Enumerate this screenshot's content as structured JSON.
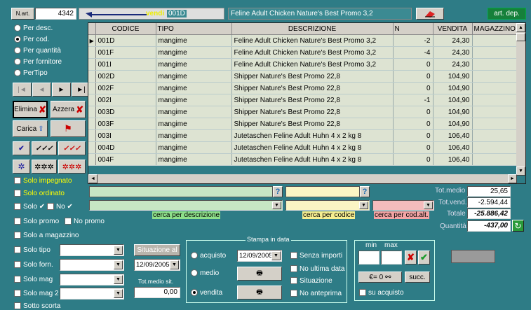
{
  "top": {
    "nart_label": "N.art.",
    "nart_value": "4342",
    "mode_label": "vendi",
    "code_value": "001D",
    "description_value": "Feline Adult Chicken Nature's Best Promo 3,2",
    "art_dep_label": "art. dep."
  },
  "sort": {
    "options": [
      "Per desc.",
      "Per cod.",
      "Per quantità",
      "Per fornitore",
      "PerTipo"
    ]
  },
  "buttons": {
    "elimina": "Elimina",
    "azzera": "Azzera",
    "carica": "Carica"
  },
  "grid": {
    "columns": [
      "CODICE",
      "TIPO",
      "DESCRIZIONE",
      "N",
      "VENDITA",
      "MAGAZZINO"
    ],
    "rows": [
      [
        "001D",
        "mangime",
        "Feline Adult Chicken Nature's Best Promo 3,2",
        "-2",
        "24,30",
        ""
      ],
      [
        "001F",
        "mangime",
        "Feline Adult Chicken Nature's Best Promo 3,2",
        "-4",
        "24,30",
        ""
      ],
      [
        "001I",
        "mangime",
        "Feline Adult Chicken Nature's Best Promo 3,2",
        "0",
        "24,30",
        ""
      ],
      [
        "002D",
        "mangime",
        "Shipper Nature's Best Promo 22,8",
        "0",
        "104,90",
        ""
      ],
      [
        "002F",
        "mangime",
        "Shipper Nature's Best Promo 22,8",
        "0",
        "104,90",
        ""
      ],
      [
        "002I",
        "mangime",
        "Shipper Nature's Best Promo 22,8",
        "-1",
        "104,90",
        ""
      ],
      [
        "003D",
        "mangime",
        "Shipper Nature's Best Promo 22,8",
        "0",
        "104,90",
        ""
      ],
      [
        "003F",
        "mangime",
        "Shipper Nature's Best Promo 22,8",
        "0",
        "104,90",
        ""
      ],
      [
        "003I",
        "mangime",
        "Jutetaschen Feline Adult Huhn 4 x 2 kg 8",
        "0",
        "106,40",
        ""
      ],
      [
        "004D",
        "mangime",
        "Jutetaschen Feline Adult Huhn 4 x 2 kg 8",
        "0",
        "106,40",
        ""
      ],
      [
        "004F",
        "mangime",
        "Jutetaschen Feline Adult Huhn 4 x 2 kg 8",
        "0",
        "106,40",
        ""
      ]
    ]
  },
  "filters": {
    "solo_impegnato": "Solo impegnato",
    "solo_ordinato": "Solo ordinato",
    "solo": "Solo",
    "no": "No",
    "solo_promo": "Solo promo",
    "no_promo": "No promo",
    "solo_a_magazzino": "Solo a magazzino",
    "solo_tipo": "Solo tipo",
    "solo_forn": "Solo forn.",
    "solo_mag": "Solo mag",
    "solo_mag2": "Solo mag 2",
    "sotto_scorta": "Sotto scorta"
  },
  "search": {
    "descrizione": "cerca per descrizione",
    "codice": "cerca per codice",
    "cod_alt": "cerca per cod.alt."
  },
  "totals": {
    "tot_medio_label": "Tot.medio",
    "tot_medio": "25,65",
    "tot_vend_label": "Tot.vend.",
    "tot_vend": "-2.594,44",
    "totale_label": "Totale",
    "totale": "-25.886,42",
    "quantita_label": "Quantità",
    "quantita": "-437,00"
  },
  "situazione": {
    "button": "Situazione al",
    "date": "12/09/2005",
    "totmedio_label": "Tot.medio sit.",
    "totmedio_value": "0,00"
  },
  "stampa": {
    "title": "Stampa in data",
    "acquisto": "acquisto",
    "medio": "medio",
    "vendita": "vendita",
    "date": "12/09/2005",
    "senza_importi": "Senza importi",
    "no_ultima_data": "No ultima data",
    "situazione": "Situazione",
    "no_anteprima": "No anteprima"
  },
  "minmax": {
    "min_label": "min",
    "max_label": "max",
    "euro_button": "€= 0",
    "succ_button": "succ.",
    "su_acquisto": "su acquisto"
  }
}
